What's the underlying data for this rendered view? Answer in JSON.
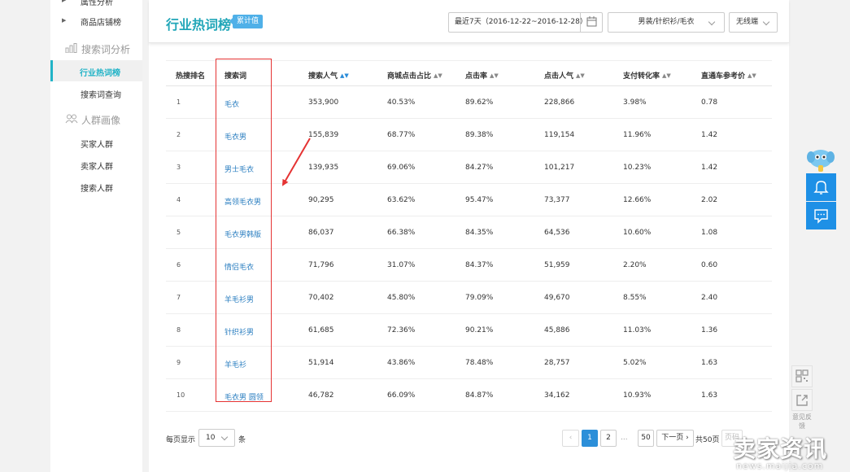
{
  "sidebar": {
    "items_top": [
      {
        "label": "属性分析"
      },
      {
        "label": "商品店铺榜"
      }
    ],
    "group_search": "搜索词分析",
    "search_items": [
      {
        "label": "行业热词榜"
      },
      {
        "label": "搜索词查询"
      }
    ],
    "group_crowd": "人群画像",
    "crowd_items": [
      {
        "label": "买家人群"
      },
      {
        "label": "卖家人群"
      },
      {
        "label": "搜索人群"
      }
    ]
  },
  "header": {
    "title": "行业热词榜",
    "tag": "累计值",
    "date_range": "最近7天（2016-12-22~2016-12-28）",
    "category": "男装/针织衫/毛衣",
    "device": "无线端"
  },
  "table": {
    "columns": [
      "热搜排名",
      "搜索词",
      "搜索人气",
      "商城点击占比",
      "点击率",
      "点击人气",
      "支付转化率",
      "直通车参考价"
    ],
    "rows": [
      [
        "1",
        "毛衣",
        "353,900",
        "40.53%",
        "89.62%",
        "228,866",
        "3.98%",
        "0.78"
      ],
      [
        "2",
        "毛衣男",
        "155,839",
        "68.77%",
        "89.38%",
        "119,154",
        "11.96%",
        "1.42"
      ],
      [
        "3",
        "男士毛衣",
        "139,935",
        "69.06%",
        "84.27%",
        "101,217",
        "10.23%",
        "1.42"
      ],
      [
        "4",
        "高领毛衣男",
        "90,295",
        "63.62%",
        "95.47%",
        "73,377",
        "12.66%",
        "2.02"
      ],
      [
        "5",
        "毛衣男韩版",
        "86,037",
        "66.38%",
        "84.35%",
        "64,536",
        "10.60%",
        "1.08"
      ],
      [
        "6",
        "情侣毛衣",
        "71,796",
        "31.07%",
        "84.37%",
        "51,959",
        "2.20%",
        "0.60"
      ],
      [
        "7",
        "羊毛衫男",
        "70,402",
        "45.80%",
        "79.09%",
        "49,670",
        "8.55%",
        "2.40"
      ],
      [
        "8",
        "针织衫男",
        "61,685",
        "72.36%",
        "90.21%",
        "45,886",
        "11.03%",
        "1.36"
      ],
      [
        "9",
        "羊毛衫",
        "51,914",
        "43.86%",
        "78.48%",
        "28,757",
        "5.02%",
        "1.63"
      ],
      [
        "10",
        "毛衣男 圆领",
        "46,782",
        "66.09%",
        "84.87%",
        "34,162",
        "10.93%",
        "1.63"
      ]
    ]
  },
  "pagination": {
    "per_page_label": "每页显示",
    "per_page_value": "10",
    "per_page_suffix": "条",
    "pages": [
      "1",
      "2",
      "50"
    ],
    "next": "下一页",
    "total": "共50页",
    "goto": "页码",
    "ellipsis": "..."
  },
  "tools": {
    "feedback": "意见反馈"
  },
  "watermark": {
    "brand": "卖家资讯",
    "url": "news.maijia.com"
  },
  "colors": {
    "accent": "#21b3c7",
    "link": "#2a7ec0",
    "primary_btn": "#2c8fd9",
    "annotation": "#e53333"
  }
}
